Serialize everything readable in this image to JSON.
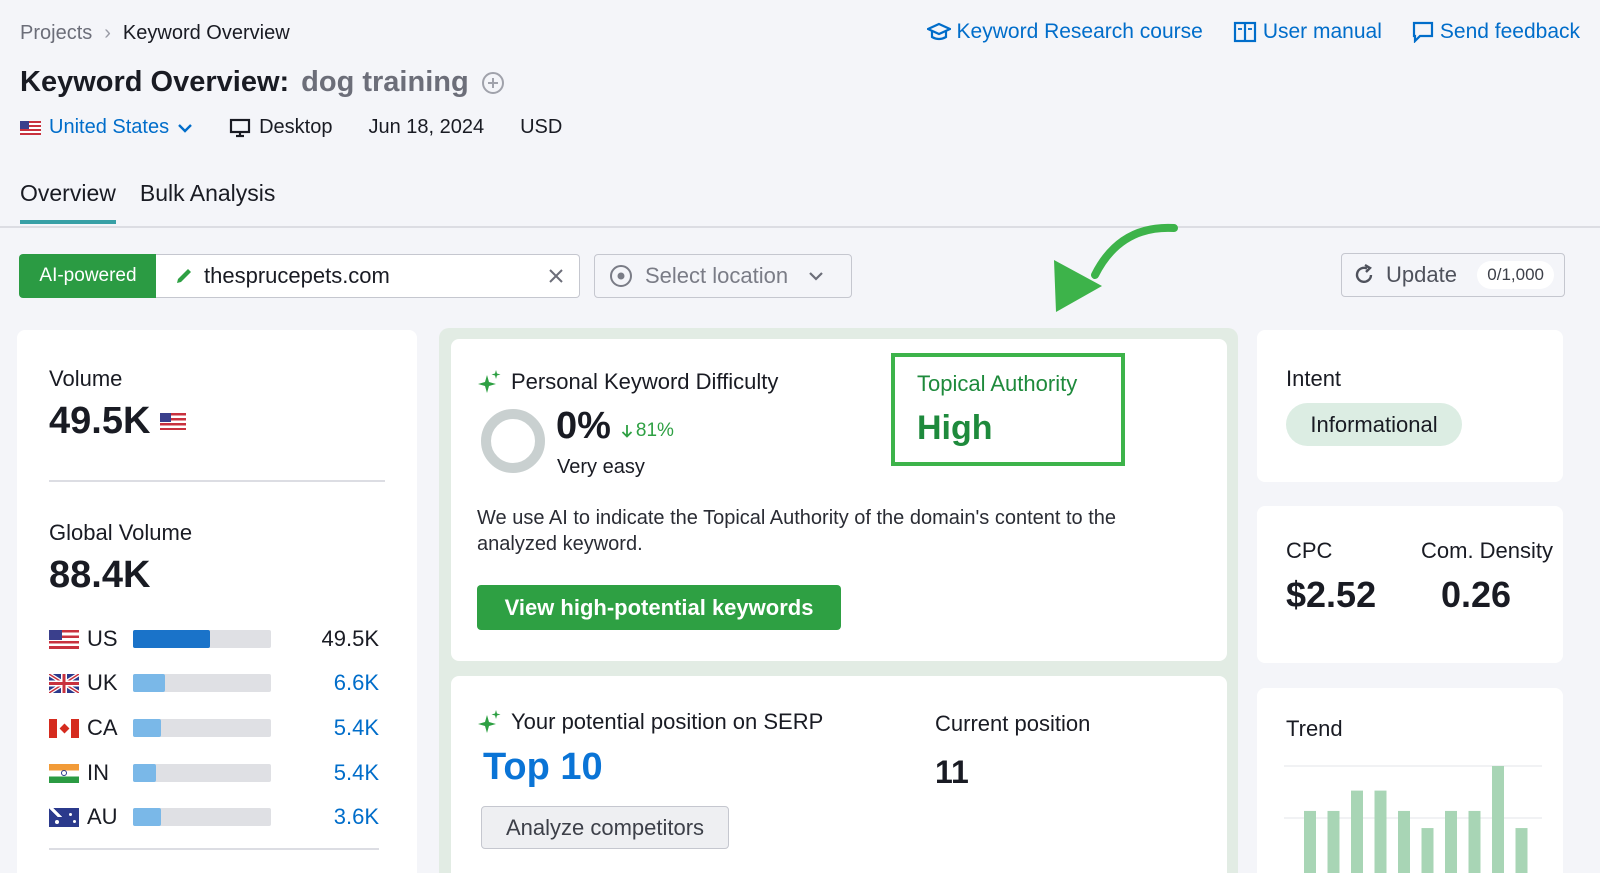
{
  "breadcrumb": {
    "parent": "Projects",
    "current": "Keyword Overview"
  },
  "top_links": [
    {
      "label": "Keyword Research course",
      "icon": "graduation-cap-icon"
    },
    {
      "label": "User manual",
      "icon": "book-icon"
    },
    {
      "label": "Send feedback",
      "icon": "feedback-icon"
    }
  ],
  "page": {
    "title_prefix": "Keyword Overview:",
    "keyword": "dog training"
  },
  "meta": {
    "country": "United States",
    "device": "Desktop",
    "date": "Jun 18, 2024",
    "currency": "USD"
  },
  "tabs": [
    {
      "label": "Overview",
      "active": true
    },
    {
      "label": "Bulk Analysis",
      "active": false
    }
  ],
  "toolbar": {
    "ai_label": "AI-powered",
    "domain_value": "thesprucepets.com",
    "location_placeholder": "Select location",
    "update_label": "Update",
    "update_count": "0/1,000"
  },
  "volume": {
    "label": "Volume",
    "value": "49.5K"
  },
  "global_volume": {
    "label": "Global Volume",
    "value": "88.4K",
    "countries": [
      {
        "code": "US",
        "value": "49.5K",
        "share": 0.56
      },
      {
        "code": "UK",
        "value": "6.6K",
        "share": 0.23
      },
      {
        "code": "CA",
        "value": "5.4K",
        "share": 0.2
      },
      {
        "code": "IN",
        "value": "5.4K",
        "share": 0.17
      },
      {
        "code": "AU",
        "value": "3.6K",
        "share": 0.2
      }
    ]
  },
  "pkd": {
    "title": "Personal Keyword Difficulty",
    "value": "0%",
    "change": "81%",
    "level": "Very easy",
    "topical_authority_label": "Topical Authority",
    "topical_authority_value": "High",
    "description": "We use AI to indicate the Topical Authority of the domain's content to the analyzed keyword.",
    "button": "View high-potential keywords"
  },
  "serp": {
    "title": "Your potential position on SERP",
    "value": "Top 10",
    "current_label": "Current position",
    "current_value": "11",
    "button": "Analyze competitors"
  },
  "intent": {
    "label": "Intent",
    "value": "Informational"
  },
  "cpc": {
    "label": "CPC",
    "value": "$2.52"
  },
  "density": {
    "label": "Com. Density",
    "value": "0.26"
  },
  "trend": {
    "label": "Trend",
    "values": [
      0.58,
      0.58,
      0.77,
      0.77,
      0.58,
      0.42,
      0.58,
      0.58,
      1.0,
      0.42
    ]
  },
  "colors": {
    "green": "#2ea043",
    "blue": "#006dca",
    "bar_us": "#1a73c9",
    "bar_other": "#7ab8e8",
    "trend": "#a8d5b5"
  }
}
